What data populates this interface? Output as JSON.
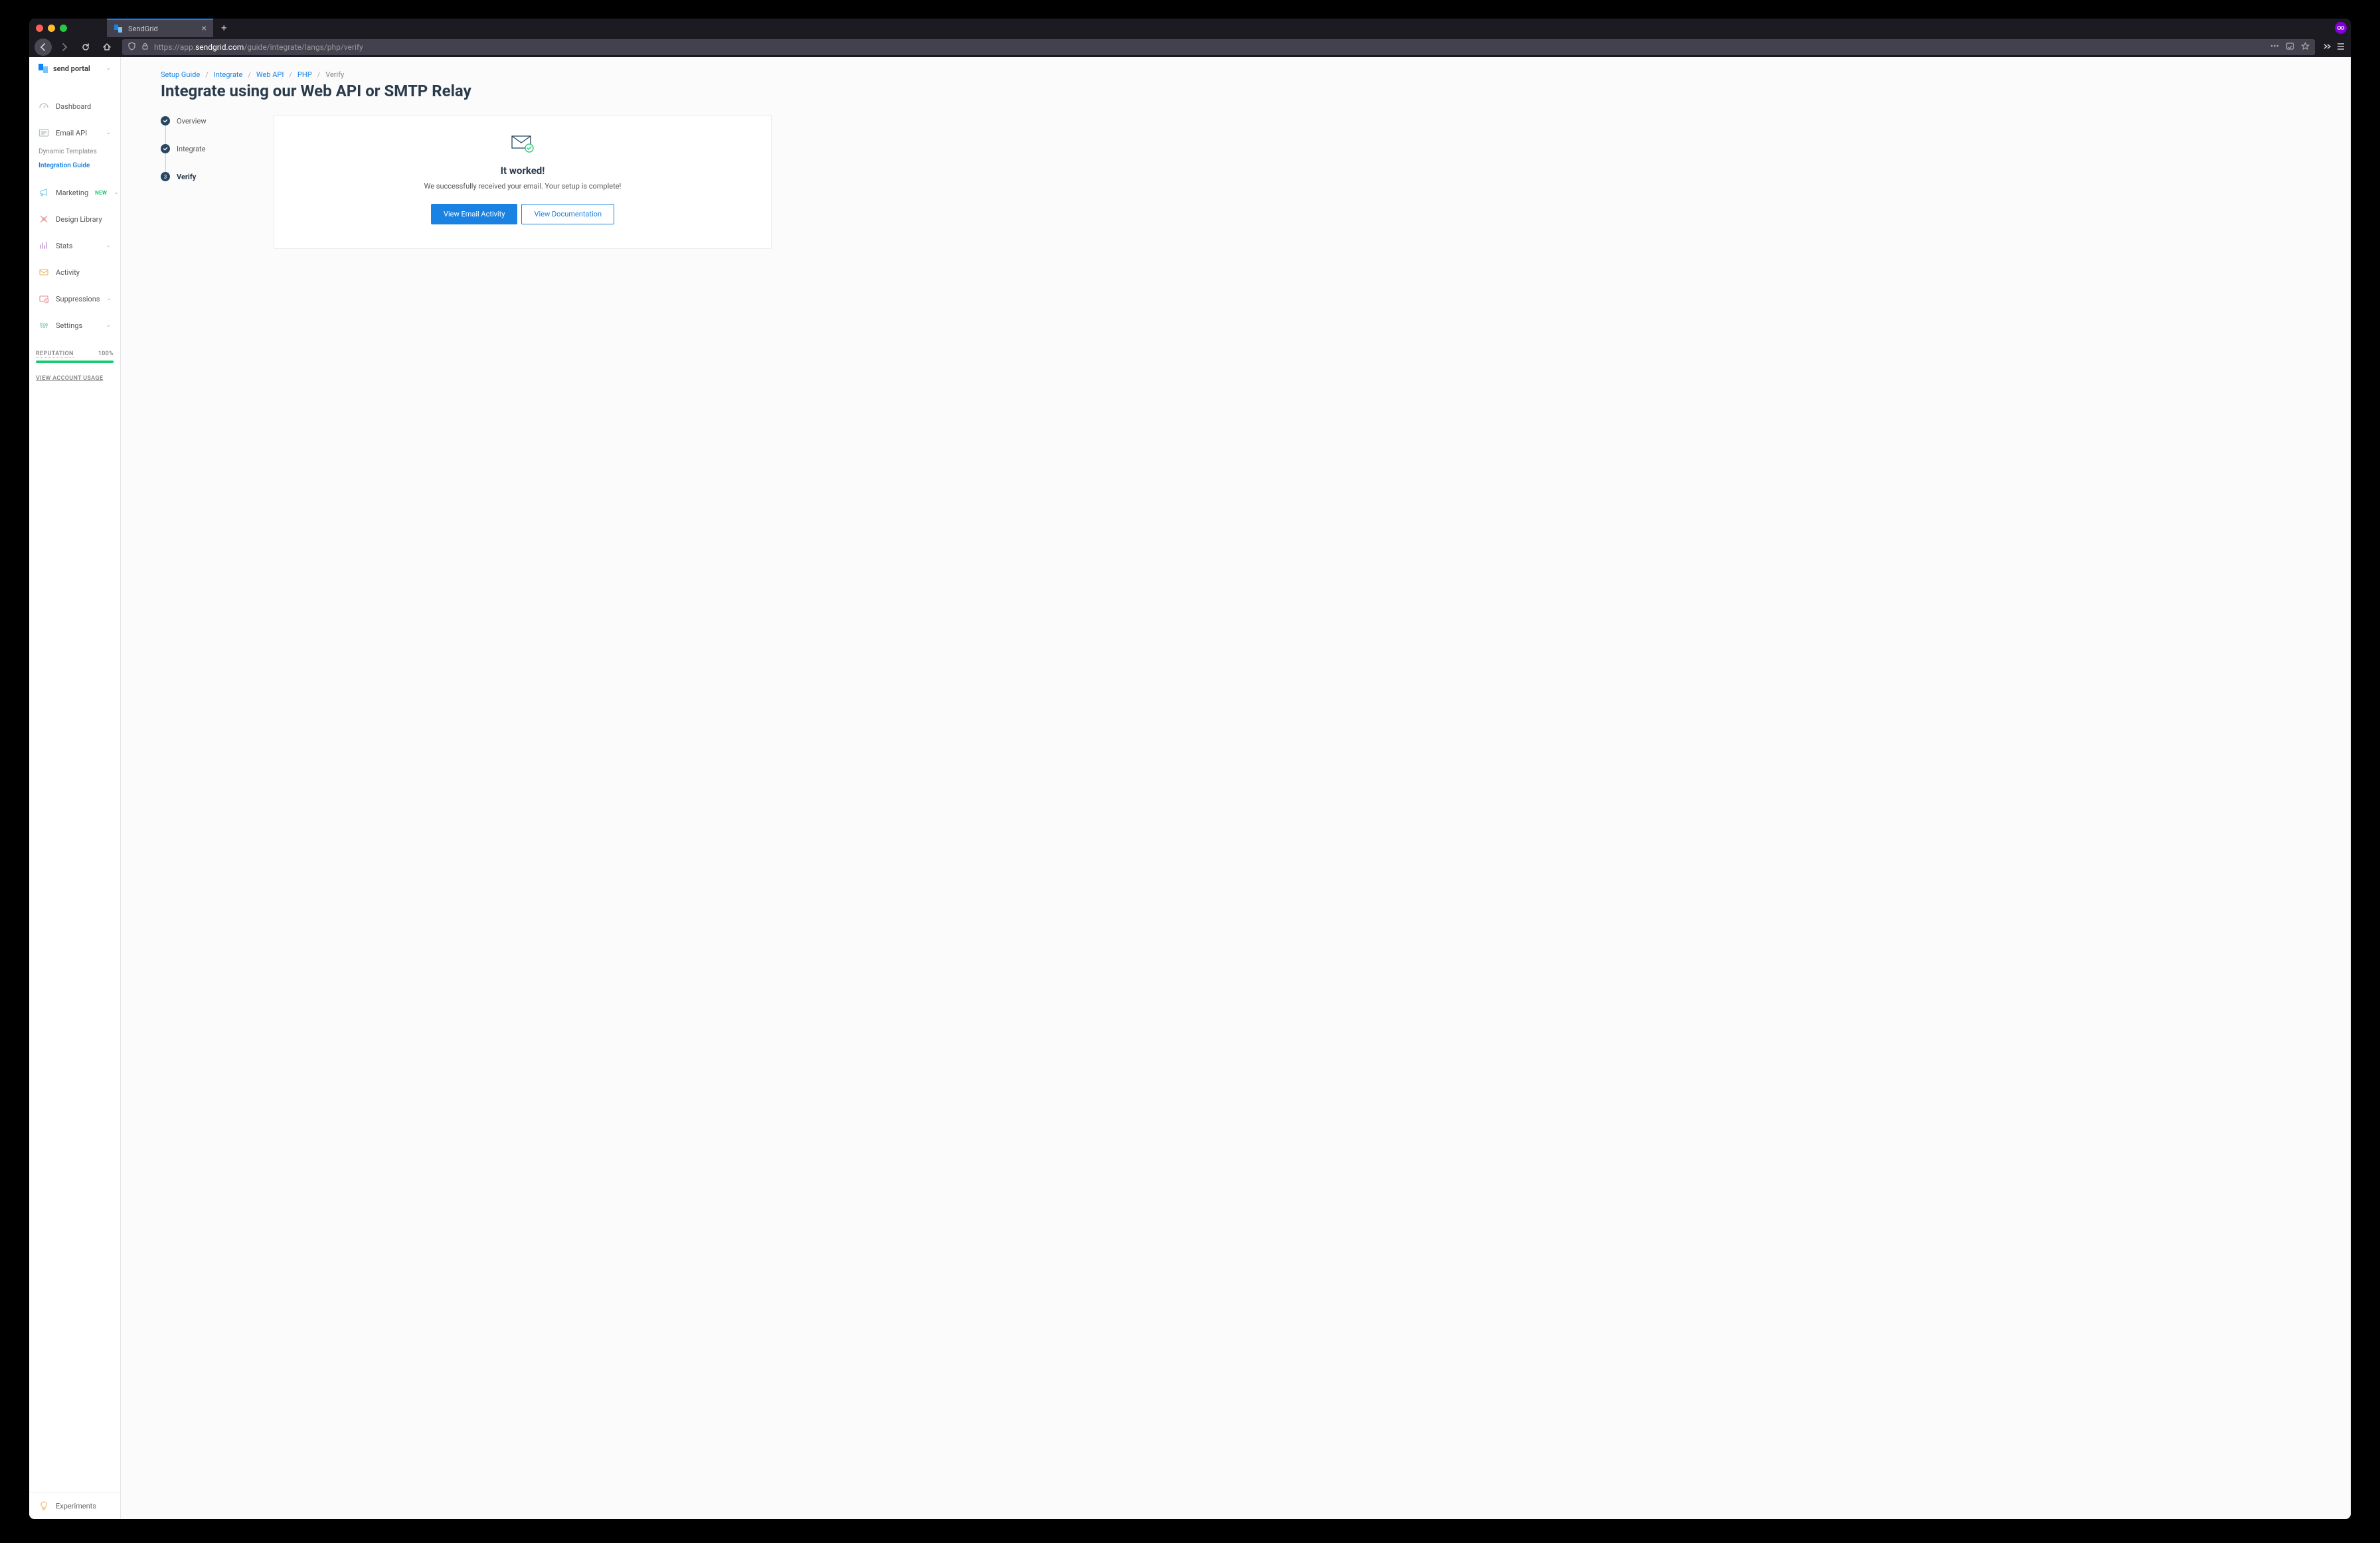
{
  "browser": {
    "tab_title": "SendGrid",
    "url_prefix": "https://app.",
    "url_domain": "sendgrid.com",
    "url_path": "/guide/integrate/langs/php/verify"
  },
  "sidebar": {
    "org_name": "send portal",
    "nav": {
      "dashboard": "Dashboard",
      "email_api": "Email API",
      "dynamic_templates": "Dynamic Templates",
      "integration_guide": "Integration Guide",
      "marketing": "Marketing",
      "marketing_badge": "NEW",
      "design_library": "Design Library",
      "stats": "Stats",
      "activity": "Activity",
      "suppressions": "Suppressions",
      "settings": "Settings"
    },
    "reputation": {
      "label": "REPUTATION",
      "value": "100%"
    },
    "usage_link": "VIEW ACCOUNT USAGE",
    "experiments": "Experiments"
  },
  "breadcrumb": {
    "setup_guide": "Setup Guide",
    "integrate": "Integrate",
    "web_api": "Web API",
    "php": "PHP",
    "verify": "Verify"
  },
  "page_title": "Integrate using our Web API or SMTP Relay",
  "stepper": {
    "overview": "Overview",
    "integrate": "Integrate",
    "verify_num": "3",
    "verify": "Verify"
  },
  "card": {
    "title": "It worked!",
    "description": "We successfully received your email. Your setup is complete!",
    "btn_activity": "View Email Activity",
    "btn_docs": "View Documentation"
  }
}
